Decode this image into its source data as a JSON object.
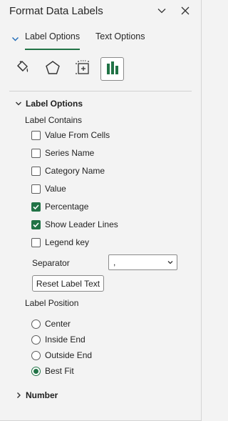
{
  "pane": {
    "title": "Format Data Labels"
  },
  "tabs": [
    {
      "label": "Label Options",
      "active": true
    },
    {
      "label": "Text Options",
      "active": false
    }
  ],
  "icon_categories": [
    {
      "name": "fill-line-icon",
      "selected": false
    },
    {
      "name": "effects-icon",
      "selected": false
    },
    {
      "name": "size-properties-icon",
      "selected": false
    },
    {
      "name": "label-options-icon",
      "selected": true
    }
  ],
  "label_options": {
    "header": "Label Options",
    "contains_heading": "Label Contains",
    "checkboxes": [
      {
        "label": "Value From Cells",
        "checked": false
      },
      {
        "label": "Series Name",
        "checked": false
      },
      {
        "label": "Category Name",
        "checked": false
      },
      {
        "label": "Value",
        "checked": false
      },
      {
        "label": "Percentage",
        "checked": true
      },
      {
        "label": "Show Leader Lines",
        "checked": true
      },
      {
        "label": "Legend key",
        "checked": false
      }
    ],
    "separator_label": "Separator",
    "separator_value": ",",
    "reset_button": "Reset Label Text",
    "position_heading": "Label Position",
    "positions": [
      {
        "label": "Center",
        "selected": false
      },
      {
        "label": "Inside End",
        "selected": false
      },
      {
        "label": "Outside End",
        "selected": false
      },
      {
        "label": "Best Fit",
        "selected": true
      }
    ]
  },
  "number_section": {
    "header": "Number"
  },
  "colors": {
    "accent": "#217346",
    "background": "#f3f3f3"
  }
}
